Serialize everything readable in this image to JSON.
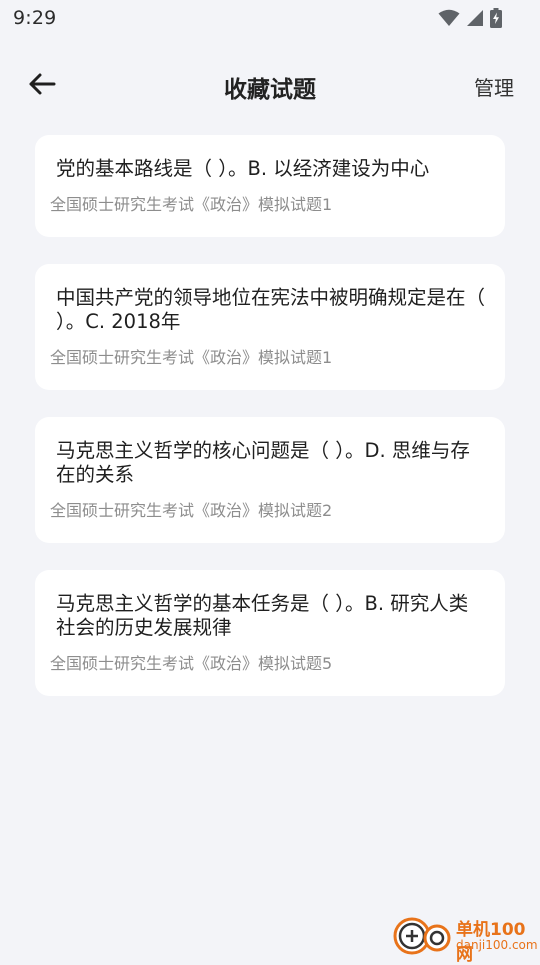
{
  "status_bar": {
    "time": "9:29",
    "icons": [
      "wifi-icon",
      "cellular-signal-icon",
      "battery-charging-icon"
    ]
  },
  "header": {
    "back_icon": "arrow-left-icon",
    "title": "收藏试题",
    "manage_label": "管理"
  },
  "questions": [
    {
      "text": "党的基本路线是（ ）。B. 以经济建设为中心",
      "source": "全国硕士研究生考试《政治》模拟试题1"
    },
    {
      "text": "中国共产党的领导地位在宪法中被明确规定是在（ ）。C. 2018年",
      "source": "全国硕士研究生考试《政治》模拟试题1"
    },
    {
      "text": "马克思主义哲学的核心问题是（ ）。D. 思维与存在的关系",
      "source": "全国硕士研究生考试《政治》模拟试题2"
    },
    {
      "text": "马克思主义哲学的基本任务是（ ）。B. 研究人类社会的历史发展规律",
      "source": "全国硕士研究生考试《政治》模拟试题5"
    }
  ],
  "watermark": {
    "name": "单机100网",
    "domain": "danji100.com"
  },
  "colors": {
    "background": "#f3f4f8",
    "card": "#ffffff",
    "primary_text": "#1f1f1f",
    "secondary_text": "#8d8d8d",
    "watermark_accent": "#e8731a"
  }
}
